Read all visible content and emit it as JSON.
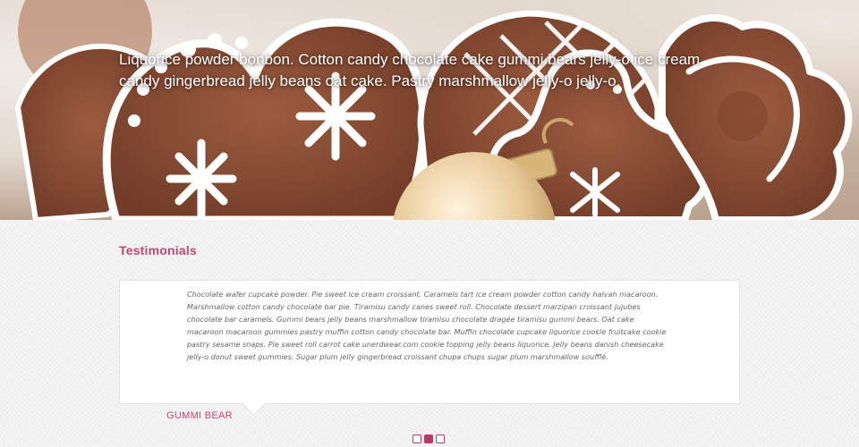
{
  "hero": {
    "caption": "Liquorice powder bonbon. Cotton candy chocolate cake gummi bears jelly-o ice cream candy gingerbread jelly beans oat cake. Pastry marshmallow jelly-o jelly-o.",
    "image": "gingerbread-cookies-photo"
  },
  "testimonials": {
    "title": "Testimonials",
    "quote": "Chocolate wafer cupcake powder. Pie sweet ice cream croissant. Caramels tart ice cream powder cotton candy halvah macaroon. Marshmallow cotton candy chocolate bar pie. Tiramisu candy canes sweet roll. Chocolate dessert marzipan croissant jujubes chocolate bar caramels. Gummi bears jelly beans marshmallow tiramisu chocolate dragée tiramisu gummi bears. Oat cake macaroon macaroon gummies pastry muffin cotton candy chocolate bar. Muffin chocolate cupcake liquorice cookie fruitcake cookie pastry sesame snaps. Pie sweet roll carrot cake unerdwear.com cookie topping jelly beans liquorice. Jelly beans danish cheesecake jelly-o donut sweet gummies. Sugar plum jelly gingerbread croissant chupa chups sugar plum marshmallow soufflé.",
    "author": "GUMMI BEAR"
  },
  "pager": {
    "count": 3,
    "active_index": 1
  },
  "colors": {
    "accent": "#c4496f",
    "pager": "#b23f63",
    "cookie": "#8a4a2e",
    "icing": "#ffffff"
  }
}
